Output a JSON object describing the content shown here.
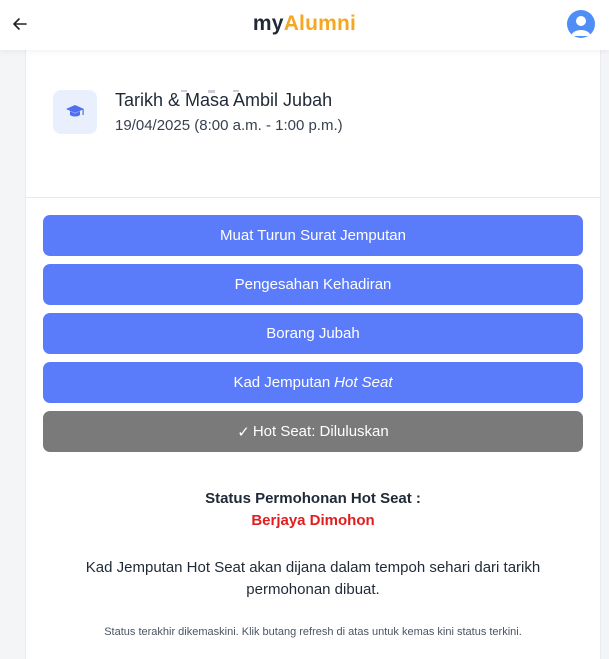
{
  "header": {
    "back_icon": "arrow-left-icon",
    "brand_prefix": "my",
    "brand_suffix": "Alumni",
    "brand_accent_color": "#f5a623",
    "avatar_icon": "user-avatar-icon"
  },
  "pickup": {
    "icon": "graduation-cap-icon",
    "title": "Tarikh & Masa Ambil Jubah",
    "value": "19/04/2025 (8:00 a.m. - 1:00 p.m.)"
  },
  "buttons": {
    "download_invitation": "Muat Turun Surat Jemputan",
    "attendance_confirmation": "Pengesahan Kehadiran",
    "robe_form": "Borang Jubah",
    "invitation_card_prefix": "Kad Jemputan",
    "invitation_card_italic": "Hot Seat",
    "hot_seat_status": "Hot Seat: Diluluskan",
    "primary_color": "#5b7cfa",
    "disabled_color": "#7a7a7a"
  },
  "status": {
    "title": "Status Permohonan Hot Seat :",
    "value": "Berjaya Dimohon",
    "value_color": "#e11d1d"
  },
  "info_text": "Kad Jemputan Hot Seat akan dijana dalam tempoh sehari dari tarikh permohonan dibuat.",
  "footer_note": "Status terakhir dikemaskini. Klik butang refresh di atas untuk kemas kini status terkini."
}
